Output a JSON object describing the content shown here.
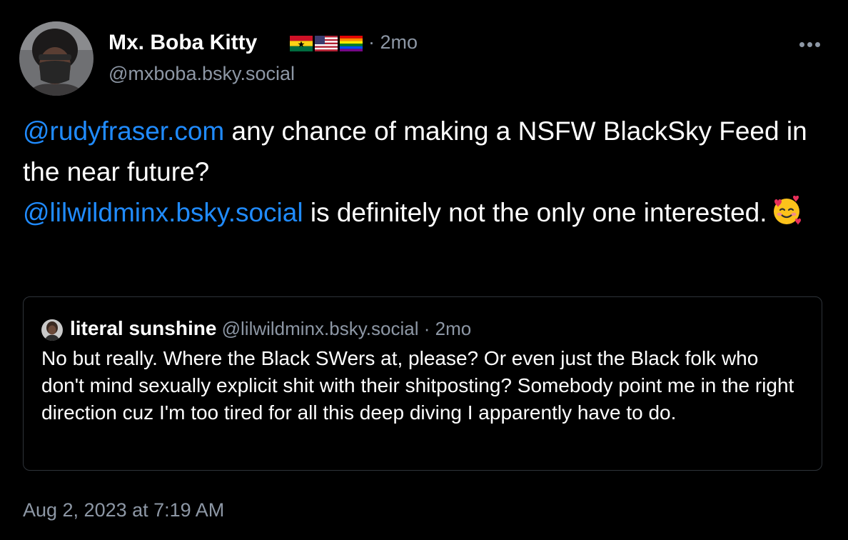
{
  "author": {
    "display_name": "Mx. Boba Kitty",
    "flags": [
      "ghana-flag-icon",
      "usa-flag-icon",
      "rainbow-flag-icon"
    ],
    "time_sep": " · 2mo",
    "handle": "@mxboba.bsky.social"
  },
  "menu": {
    "icon": "more-horizontal-icon"
  },
  "post": {
    "mention_1": "@rudyfraser.com",
    "text_1": " any chance of making a NSFW BlackSky Feed in the near future?",
    "mention_2": "@lilwildminx.bsky.social",
    "text_2": " is definitely not the only one interested.",
    "emoji": "smiling-face-with-hearts-icon"
  },
  "quote": {
    "display_name": "literal sunshine",
    "handle": " @lilwildminx.bsky.social",
    "time_sep": " · 2mo",
    "text": "No but really. Where the Black SWers at, please? Or even just the Black folk who don't mind sexually explicit shit with their shitposting? Somebody point me in the right direction cuz I'm too tired for all this deep diving I apparently have to do."
  },
  "timestamp": "Aug 2, 2023 at 7:19 AM",
  "colors": {
    "background": "#000000",
    "text": "#ffffff",
    "muted": "#8d97a5",
    "link": "#208bfe",
    "border": "#2e3339"
  }
}
